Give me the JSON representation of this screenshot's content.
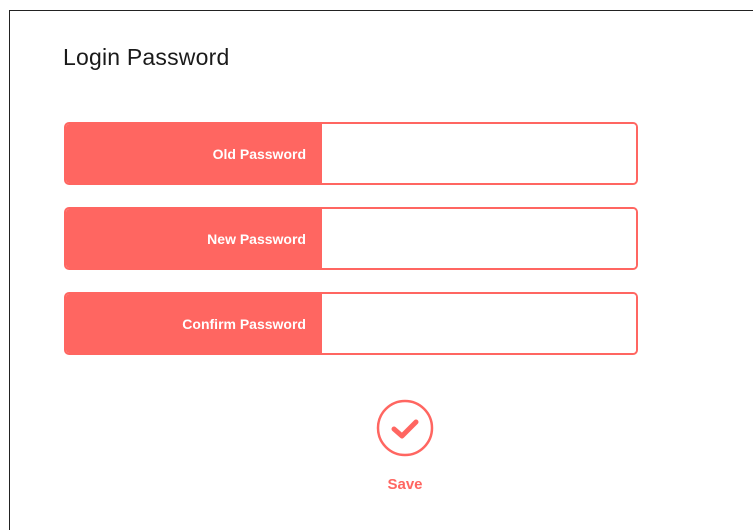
{
  "page": {
    "title": "Login Password"
  },
  "form": {
    "fields": [
      {
        "label": "Old Password",
        "value": "",
        "placeholder": ""
      },
      {
        "label": "New Password",
        "value": "",
        "placeholder": ""
      },
      {
        "label": "Confirm Password",
        "value": "",
        "placeholder": ""
      }
    ]
  },
  "actions": {
    "save_label": "Save",
    "save_icon": "check-circle-icon"
  },
  "colors": {
    "accent": "#ff6661",
    "title_text": "#1a1a1a",
    "background": "#ffffff"
  }
}
